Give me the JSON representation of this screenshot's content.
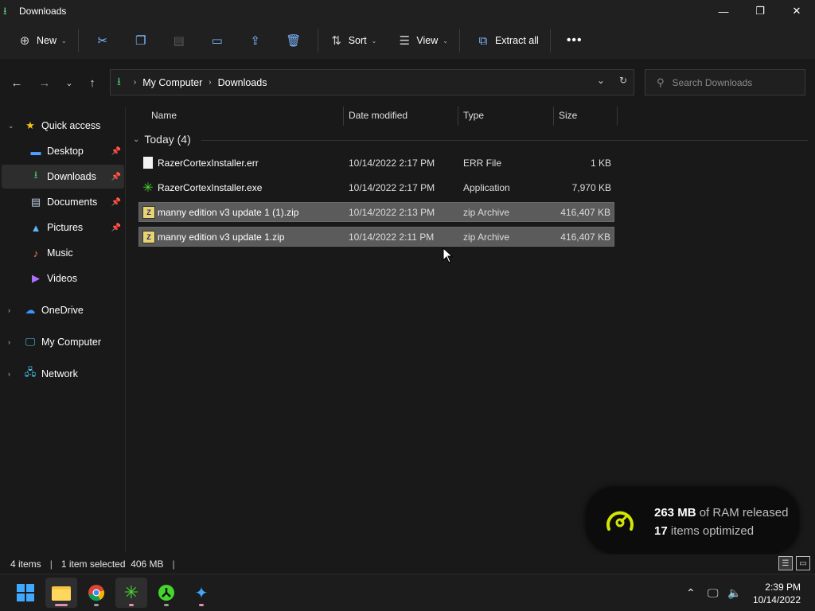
{
  "window": {
    "title": "Downloads"
  },
  "toolbar": {
    "new_label": "New",
    "sort_label": "Sort",
    "view_label": "View",
    "extract_label": "Extract all"
  },
  "address": {
    "crumbs": [
      "My Computer",
      "Downloads"
    ]
  },
  "search": {
    "placeholder": "Search Downloads"
  },
  "sidebar": {
    "quick_access": "Quick access",
    "items": [
      {
        "label": "Desktop",
        "icon": "desktop-icon",
        "pinned": true
      },
      {
        "label": "Downloads",
        "icon": "download-icon",
        "pinned": true,
        "selected": true
      },
      {
        "label": "Documents",
        "icon": "documents-icon",
        "pinned": true
      },
      {
        "label": "Pictures",
        "icon": "pictures-icon",
        "pinned": true
      },
      {
        "label": "Music",
        "icon": "music-icon"
      },
      {
        "label": "Videos",
        "icon": "videos-icon"
      }
    ],
    "roots": [
      {
        "label": "OneDrive",
        "icon": "cloud-icon"
      },
      {
        "label": "My Computer",
        "icon": "computer-icon"
      },
      {
        "label": "Network",
        "icon": "network-icon"
      }
    ]
  },
  "columns": [
    "Name",
    "Date modified",
    "Type",
    "Size"
  ],
  "group": {
    "label": "Today (4)"
  },
  "files": [
    {
      "name": "RazerCortexInstaller.err",
      "date": "10/14/2022 2:17 PM",
      "type": "ERR File",
      "size": "1 KB",
      "icon": "doc",
      "selected": false
    },
    {
      "name": "RazerCortexInstaller.exe",
      "date": "10/14/2022 2:17 PM",
      "type": "Application",
      "size": "7,970 KB",
      "icon": "razer",
      "selected": false
    },
    {
      "name": "manny edition v3 update 1 (1).zip",
      "date": "10/14/2022 2:13 PM",
      "type": "zip Archive",
      "size": "416,407 KB",
      "icon": "zip",
      "selected": true
    },
    {
      "name": "manny edition v3 update 1.zip",
      "date": "10/14/2022 2:11 PM",
      "type": "zip Archive",
      "size": "416,407 KB",
      "icon": "zip",
      "selected": true
    }
  ],
  "notification": {
    "ram_value": "263 MB",
    "ram_text": " of RAM released",
    "items_value": "17",
    "items_text": " items optimized",
    "accent": "#d4e600"
  },
  "status": {
    "items": "4 items",
    "selected": "1 item selected  406 MB"
  },
  "clock": {
    "time": "2:39 PM",
    "date": "10/14/2022"
  }
}
